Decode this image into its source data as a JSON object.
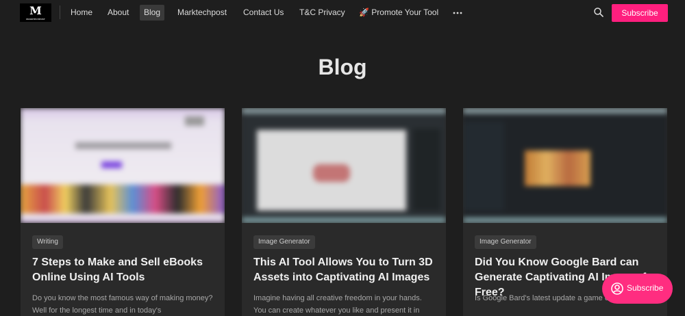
{
  "nav": {
    "logo_text": "M",
    "logo_sub": "MARKTECHPOST",
    "items": [
      {
        "label": "Home"
      },
      {
        "label": "About"
      },
      {
        "label": "Blog"
      },
      {
        "label": "Marktechpost"
      },
      {
        "label": "Contact Us"
      },
      {
        "label": "T&C Privacy"
      },
      {
        "label": "🚀 Promote Your Tool"
      }
    ],
    "more_icon": "more-horizontal-icon",
    "search_icon": "search-icon",
    "subscribe_label": "Subscribe"
  },
  "page": {
    "title": "Blog"
  },
  "posts": [
    {
      "tag": "Writing",
      "title": "7 Steps to Make and Sell eBooks Online Using AI Tools",
      "excerpt": "Do you know the most famous way of making money? Well for the longest time and in today's"
    },
    {
      "tag": "Image Generator",
      "title": "This AI Tool Allows You to Turn 3D Assets into Captivating AI Images",
      "excerpt": "Imagine having all creative freedom in your hands. You can create whatever you like and present it in"
    },
    {
      "tag": "Image Generator",
      "title": "Did You Know Google Bard can Generate Captivating AI Images for Free?",
      "excerpt": "Is Google Bard's latest update a game over for"
    }
  ],
  "floating": {
    "label": "Subscribe",
    "icon": "portal-icon"
  },
  "colors": {
    "accent": "#ff1f7e",
    "background": "#1e1e1e",
    "card": "#2a2a2a"
  }
}
